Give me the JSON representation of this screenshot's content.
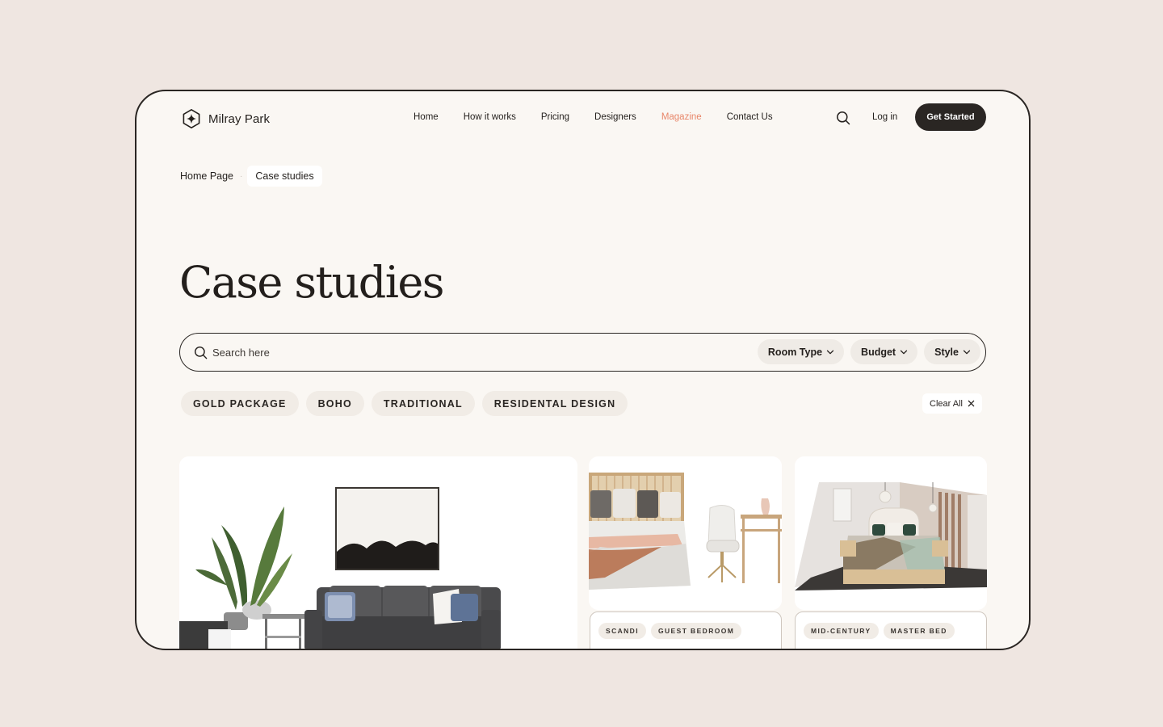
{
  "brand": {
    "name": "Milray Park"
  },
  "nav": {
    "items": [
      {
        "label": "Home",
        "active": false
      },
      {
        "label": "How it works",
        "active": false
      },
      {
        "label": "Pricing",
        "active": false
      },
      {
        "label": "Designers",
        "active": false
      },
      {
        "label": "Magazine",
        "active": true
      },
      {
        "label": "Contact Us",
        "active": false
      }
    ],
    "login_label": "Log in",
    "cta_label": "Get Started"
  },
  "breadcrumb": {
    "items": [
      "Home Page",
      "Case studies"
    ]
  },
  "page": {
    "title": "Case studies"
  },
  "search": {
    "placeholder": "Search here",
    "filters": [
      "Room Type",
      "Budget",
      "Style"
    ]
  },
  "active_tags": [
    "GOLD PACKAGE",
    "BOHO",
    "TRADITIONAL",
    "RESIDENTAL DESIGN"
  ],
  "clear_all_label": "Clear All",
  "cards": [
    {
      "tags": []
    },
    {
      "tags": [
        "SCANDI",
        "GUEST BEDROOM"
      ]
    },
    {
      "tags": [
        "MID-CENTURY",
        "MASTER BED"
      ]
    }
  ],
  "colors": {
    "background": "#efe6e1",
    "frame": "#faf7f3",
    "accent_active_nav": "#e8876a",
    "dark_button": "#2a2623",
    "chip": "#efebe6"
  },
  "icons": {
    "logo": "hexagon-sparkle-icon",
    "search": "search-icon",
    "chevron": "chevron-down-icon",
    "close": "close-icon"
  }
}
